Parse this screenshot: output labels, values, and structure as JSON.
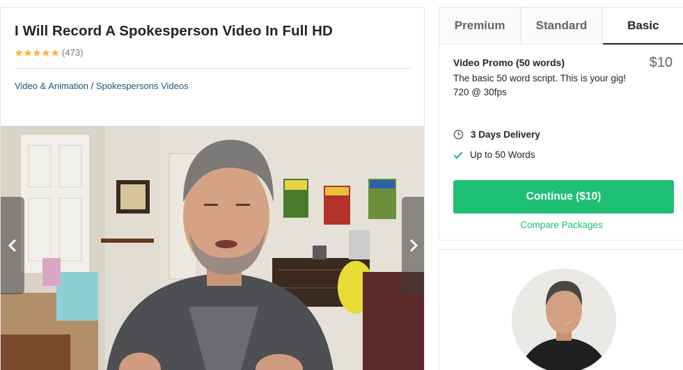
{
  "gig": {
    "title": "I Will Record A Spokesperson Video In Full HD",
    "rating_count": "(473)",
    "stars": 5,
    "category": "Video & Animation",
    "separator": " / ",
    "subcategory": "Spokespersons Videos"
  },
  "packages": {
    "tabs": [
      {
        "label": "Premium",
        "active": false
      },
      {
        "label": "Standard",
        "active": false
      },
      {
        "label": "Basic",
        "active": true
      }
    ],
    "name": "Video Promo (50 words)",
    "price": "$10",
    "description": "The basic 50 word script. This is your gig! 720 @ 30fps",
    "delivery": "3 Days Delivery",
    "feature": "Up to 50 Words",
    "continue_label": "Continue ($10)",
    "compare_label": "Compare Packages"
  },
  "colors": {
    "accent": "#1dbf73",
    "star": "#ffb33e",
    "link": "#0f5b7a"
  },
  "icons": {
    "gallery_prev": "chevron-left-icon",
    "gallery_next": "chevron-right-icon",
    "delivery": "clock-icon",
    "feature": "check-icon"
  }
}
